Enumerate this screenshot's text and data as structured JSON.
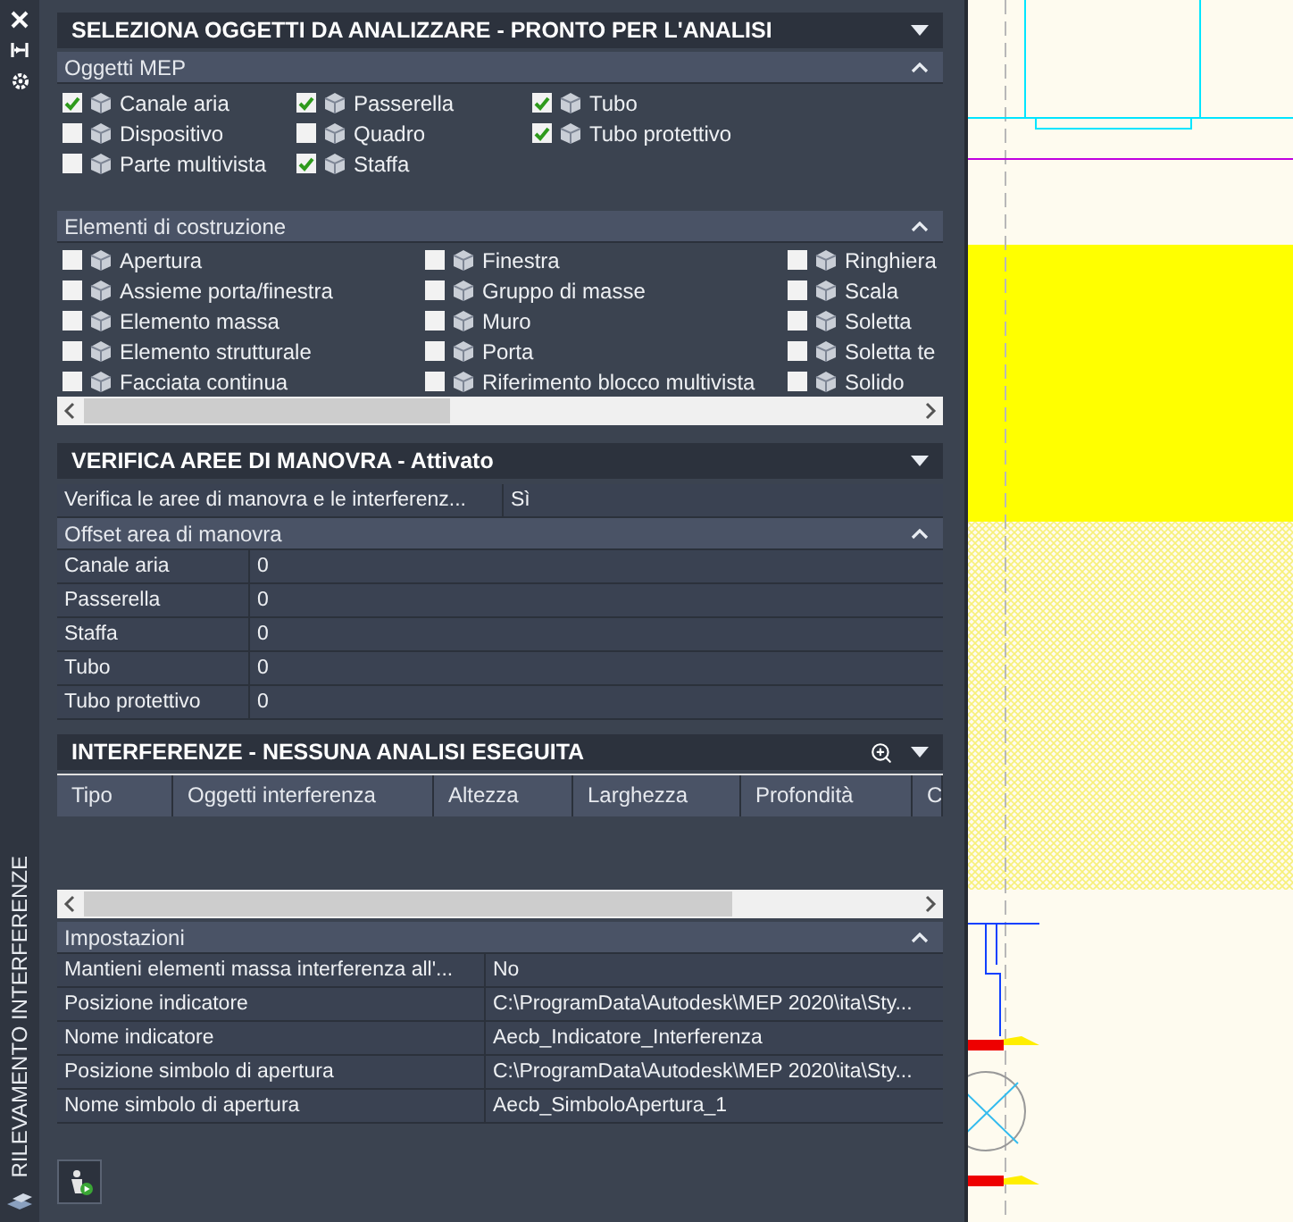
{
  "sidebar": {
    "title": "RILEVAMENTO INTERFERENZE"
  },
  "selection": {
    "title": "SELEZIONA OGGETTI DA ANALIZZARE - PRONTO PER L'ANALISI",
    "groups": [
      {
        "title": "Oggetti MEP",
        "expanded": true,
        "items": [
          {
            "label": "Canale aria",
            "checked": true
          },
          {
            "label": "Dispositivo",
            "checked": false
          },
          {
            "label": "Parte multivista",
            "checked": false
          },
          {
            "label": "Passerella",
            "checked": true
          },
          {
            "label": "Quadro",
            "checked": false
          },
          {
            "label": "Staffa",
            "checked": true
          },
          {
            "label": "Tubo",
            "checked": true
          },
          {
            "label": "Tubo protettivo",
            "checked": true
          }
        ]
      },
      {
        "title": "Elementi di costruzione",
        "expanded": true,
        "items": [
          {
            "label": "Apertura",
            "checked": false
          },
          {
            "label": "Assieme porta/finestra",
            "checked": false
          },
          {
            "label": "Elemento massa",
            "checked": false
          },
          {
            "label": "Elemento strutturale",
            "checked": false
          },
          {
            "label": "Facciata continua",
            "checked": false
          },
          {
            "label": "Finestra",
            "checked": false
          },
          {
            "label": "Gruppo di masse",
            "checked": false
          },
          {
            "label": "Muro",
            "checked": false
          },
          {
            "label": "Porta",
            "checked": false
          },
          {
            "label": "Riferimento blocco multivista",
            "checked": false
          },
          {
            "label": "Ringhiera",
            "checked": false
          },
          {
            "label": "Scala",
            "checked": false
          },
          {
            "label": "Soletta",
            "checked": false
          },
          {
            "label": "Soletta te",
            "checked": false
          },
          {
            "label": "Solido",
            "checked": false
          }
        ]
      }
    ]
  },
  "clearance": {
    "title": "VERIFICA AREE DI MANOVRA - Attivato",
    "check": {
      "label": "Verifica le aree di manovra e le interferenz...",
      "value": "Sì"
    },
    "offsets": {
      "title": "Offset area di manovra",
      "expanded": true,
      "rows": [
        {
          "label": "Canale aria",
          "value": "0"
        },
        {
          "label": "Passerella",
          "value": "0"
        },
        {
          "label": "Staffa",
          "value": "0"
        },
        {
          "label": "Tubo",
          "value": "0"
        },
        {
          "label": "Tubo protettivo",
          "value": "0"
        }
      ]
    }
  },
  "interferences": {
    "title": "INTERFERENZE - NESSUNA ANALISI ESEGUITA",
    "columns": [
      "Tipo",
      "Oggetti interferenza",
      "Altezza",
      "Larghezza",
      "Profondità",
      "C"
    ],
    "settings": {
      "title": "Impostazioni",
      "expanded": true,
      "rows": [
        {
          "label": "Mantieni elementi massa interferenza all'...",
          "value": "No"
        },
        {
          "label": "Posizione indicatore",
          "value": "C:\\ProgramData\\Autodesk\\MEP 2020\\ita\\Sty..."
        },
        {
          "label": "Nome indicatore",
          "value": "Aecb_Indicatore_Interferenza"
        },
        {
          "label": "Posizione simbolo di apertura",
          "value": "C:\\ProgramData\\Autodesk\\MEP 2020\\ita\\Sty..."
        },
        {
          "label": "Nome simbolo di apertura",
          "value": "Aecb_SimboloApertura_1"
        }
      ]
    }
  }
}
